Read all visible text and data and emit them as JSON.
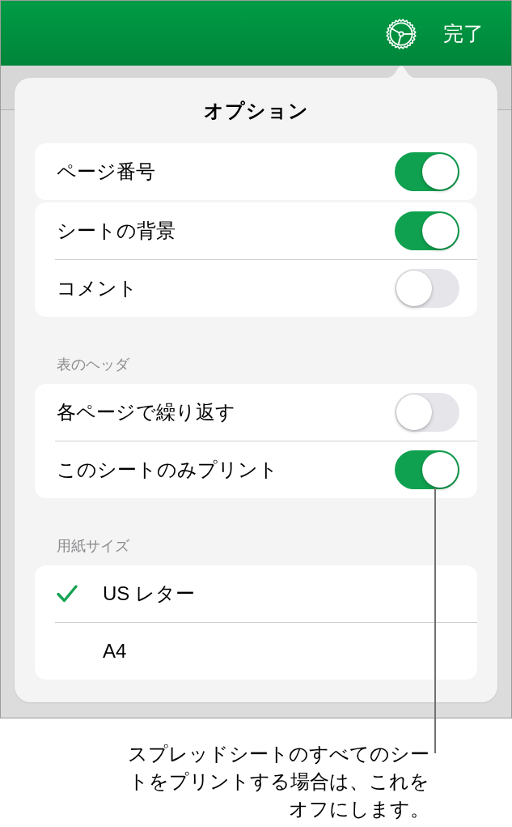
{
  "toolbar": {
    "done": "完了"
  },
  "popover": {
    "title": "オプション",
    "groups": [
      {
        "kind": "switches",
        "rows": [
          {
            "label": "ページ番号",
            "on": true
          }
        ]
      },
      {
        "kind": "switches",
        "rows": [
          {
            "label": "シートの背景",
            "on": true
          },
          {
            "label": "コメント",
            "on": false
          }
        ]
      },
      {
        "kind": "switches",
        "header": "表のヘッダ",
        "rows": [
          {
            "label": "各ページで繰り返す",
            "on": false
          },
          {
            "label": "このシートのみプリント",
            "on": true
          }
        ]
      },
      {
        "kind": "choices",
        "header": "用紙サイズ",
        "rows": [
          {
            "label": "US レター",
            "selected": true
          },
          {
            "label": "A4",
            "selected": false
          }
        ]
      }
    ]
  },
  "callout": {
    "text": "スプレッドシートのすべてのシートをプリントする場合は、これをオフにします。"
  }
}
